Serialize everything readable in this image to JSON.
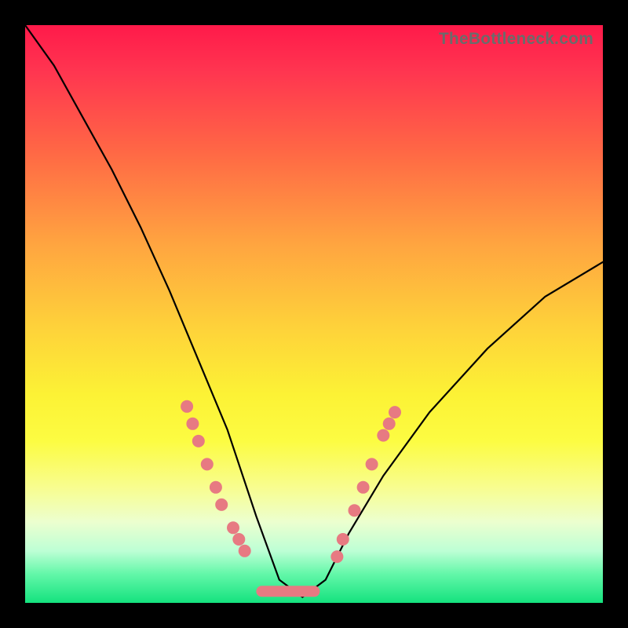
{
  "watermark": "TheBottleneck.com",
  "chart_data": {
    "type": "line",
    "title": "",
    "xlabel": "",
    "ylabel": "",
    "xlim": [
      0,
      100
    ],
    "ylim": [
      0,
      100
    ],
    "note": "V-shaped bottleneck curve with vertical gradient background (red=high bottleneck at top, green=low at bottom). Curve minimum near x≈42–50. Markers cluster along both descending and ascending arms in the lower yellow/green band; a rounded bar spans the trough.",
    "series": [
      {
        "name": "bottleneck-curve",
        "x": [
          0,
          5,
          10,
          15,
          20,
          25,
          30,
          35,
          40,
          44,
          48,
          52,
          56,
          62,
          70,
          80,
          90,
          100
        ],
        "y": [
          100,
          93,
          84,
          75,
          65,
          54,
          42,
          30,
          15,
          4,
          1,
          4,
          12,
          22,
          33,
          44,
          53,
          59
        ]
      }
    ],
    "markers": {
      "left_arm": [
        {
          "x": 28,
          "y": 34
        },
        {
          "x": 29,
          "y": 31
        },
        {
          "x": 30,
          "y": 28
        },
        {
          "x": 31.5,
          "y": 24
        },
        {
          "x": 33,
          "y": 20
        },
        {
          "x": 34,
          "y": 17
        },
        {
          "x": 36,
          "y": 13
        },
        {
          "x": 37,
          "y": 11
        },
        {
          "x": 38,
          "y": 9
        }
      ],
      "right_arm": [
        {
          "x": 54,
          "y": 8
        },
        {
          "x": 55,
          "y": 11
        },
        {
          "x": 57,
          "y": 16
        },
        {
          "x": 58.5,
          "y": 20
        },
        {
          "x": 60,
          "y": 24
        },
        {
          "x": 62,
          "y": 29
        },
        {
          "x": 63,
          "y": 31
        },
        {
          "x": 64,
          "y": 33
        }
      ],
      "trough_bar": {
        "x_start": 40,
        "x_end": 51,
        "y": 2
      }
    },
    "gradient_stops": [
      {
        "pct": 0,
        "color": "#ff1a4a"
      },
      {
        "pct": 22,
        "color": "#ff6845"
      },
      {
        "pct": 52,
        "color": "#fed13a"
      },
      {
        "pct": 80,
        "color": "#f8fd8f"
      },
      {
        "pct": 100,
        "color": "#14e27e"
      }
    ]
  }
}
